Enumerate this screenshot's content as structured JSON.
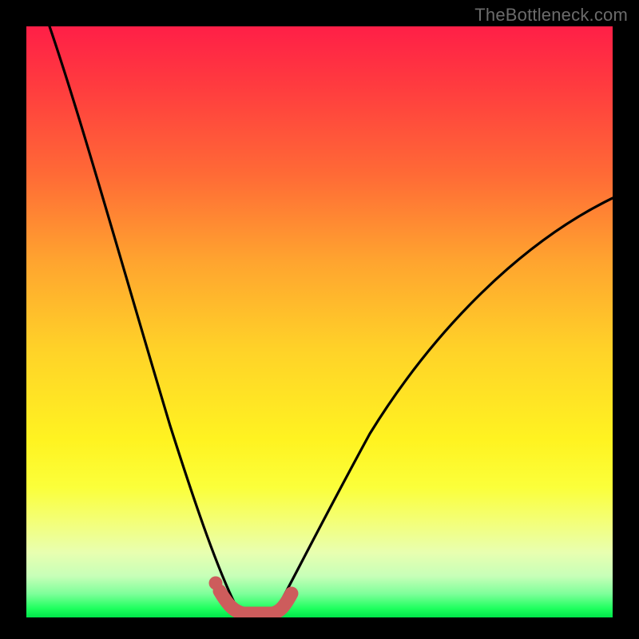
{
  "watermark": {
    "text": "TheBottleneck.com"
  },
  "colors": {
    "background": "#000000",
    "curve": "#000000",
    "marker": "#cd5c5c",
    "gradient_top": "#ff1f47",
    "gradient_bottom": "#00e44a"
  },
  "chart_data": {
    "type": "line",
    "title": "",
    "xlabel": "",
    "ylabel": "",
    "xlim": [
      0,
      100
    ],
    "ylim": [
      0,
      100
    ],
    "grid": false,
    "annotations": [],
    "series": [
      {
        "name": "left-branch",
        "x": [
          4,
          8,
          12,
          16,
          20,
          24,
          27,
          30,
          32,
          34,
          35.5,
          37
        ],
        "y": [
          100,
          82,
          65,
          49,
          35,
          22,
          13,
          7,
          4,
          2,
          1,
          0
        ]
      },
      {
        "name": "right-branch",
        "x": [
          42,
          44,
          47,
          52,
          58,
          66,
          76,
          88,
          100
        ],
        "y": [
          0,
          2,
          6,
          14,
          24,
          36,
          49,
          61,
          71
        ]
      },
      {
        "name": "marker-band",
        "x": [
          33,
          34.5,
          36,
          37.5,
          39,
          40.5,
          42,
          43.5
        ],
        "y": [
          4.5,
          1.6,
          0.6,
          0.4,
          0.4,
          0.6,
          1.6,
          4.5
        ]
      }
    ],
    "marker_dot": {
      "x": 32,
      "y": 6
    }
  }
}
